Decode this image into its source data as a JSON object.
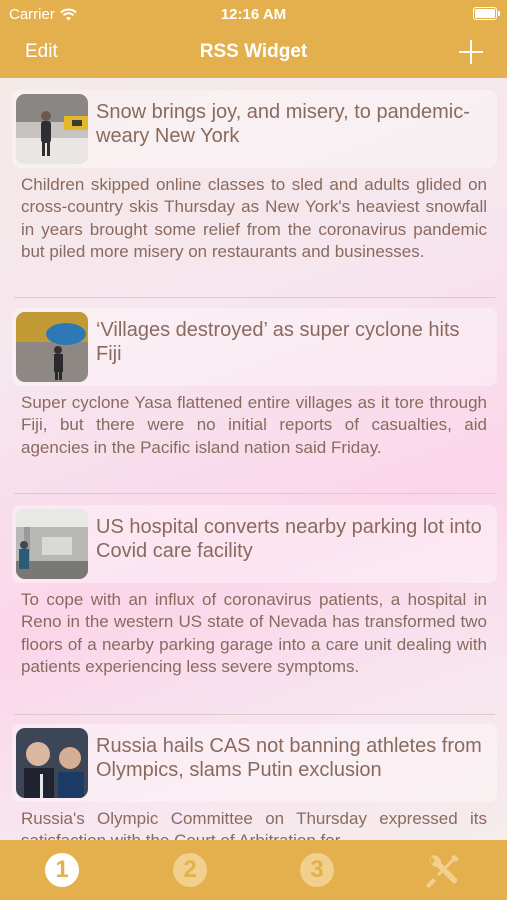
{
  "status_bar": {
    "carrier": "Carrier",
    "time": "12:16 AM"
  },
  "nav": {
    "edit_label": "Edit",
    "title": "RSS Widget"
  },
  "items": [
    {
      "headline": "Snow brings joy, and misery, to pandemic-weary New York",
      "summary": "Children skipped online classes to sled and adults glided on cross-country skis Thursday as New York's heaviest snowfall in years brought some relief from the coronavirus pandemic but piled more misery on restaurants and businesses."
    },
    {
      "headline": "‘Villages destroyed’ as super cyclone hits Fiji",
      "summary": "Super cyclone Yasa flattened entire villages as it tore through Fiji, but there were no initial reports of casualties, aid agencies in the Pacific island nation said Friday."
    },
    {
      "headline": "US hospital converts nearby parking lot into Covid care facility",
      "summary": "To cope with an influx of coronavirus patients, a hospital in Reno in the western US state of Nevada has transformed two floors of a nearby parking garage into a care unit dealing with patients experiencing less severe symptoms."
    },
    {
      "headline": "Russia hails CAS not banning athletes from Olympics, slams Putin exclusion",
      "summary": "Russia's Olympic Committee on Thursday expressed its satisfaction with the Court of Arbitration for"
    }
  ],
  "tabs": [
    {
      "label": "1",
      "icon": "tab-1-icon"
    },
    {
      "label": "2",
      "icon": "tab-2-icon"
    },
    {
      "label": "3",
      "icon": "tab-3-icon"
    },
    {
      "label": "",
      "icon": "tools-icon"
    }
  ],
  "colors": {
    "accent": "#e4b04d",
    "text": "#8a6a5e"
  }
}
